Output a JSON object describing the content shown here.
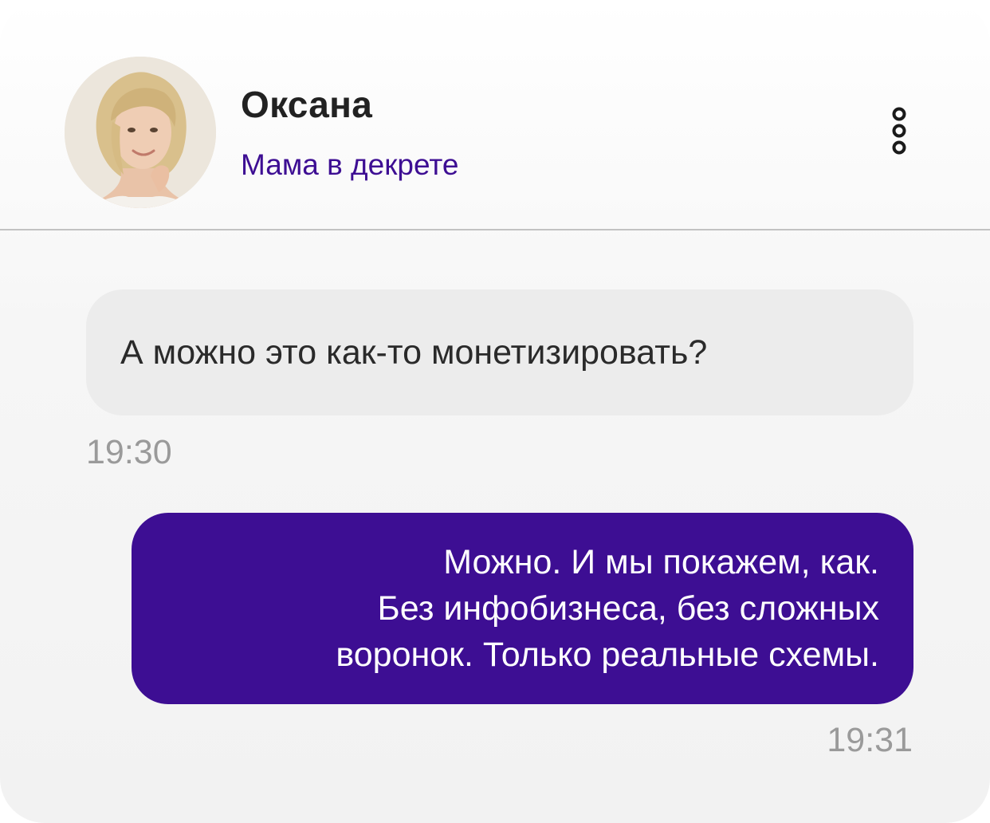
{
  "chat_header": {
    "contact_name": "Оксана",
    "contact_status": "Мама в декрете",
    "avatar": "contact-photo",
    "menu_icon": "more-vertical-icon"
  },
  "messages": [
    {
      "direction": "incoming",
      "text": "А можно это как-то монетизировать?",
      "time": "19:30"
    },
    {
      "direction": "outgoing",
      "text": "Можно. И мы покажем, как.\nБез инфобизнеса, без сложных\nворонок. Только реальные схемы.",
      "time": "19:31"
    }
  ],
  "colors": {
    "accent": "#3d0e93",
    "incoming_bubble": "#ececec",
    "timestamp": "#9a9a9a",
    "name_text": "#222222"
  }
}
